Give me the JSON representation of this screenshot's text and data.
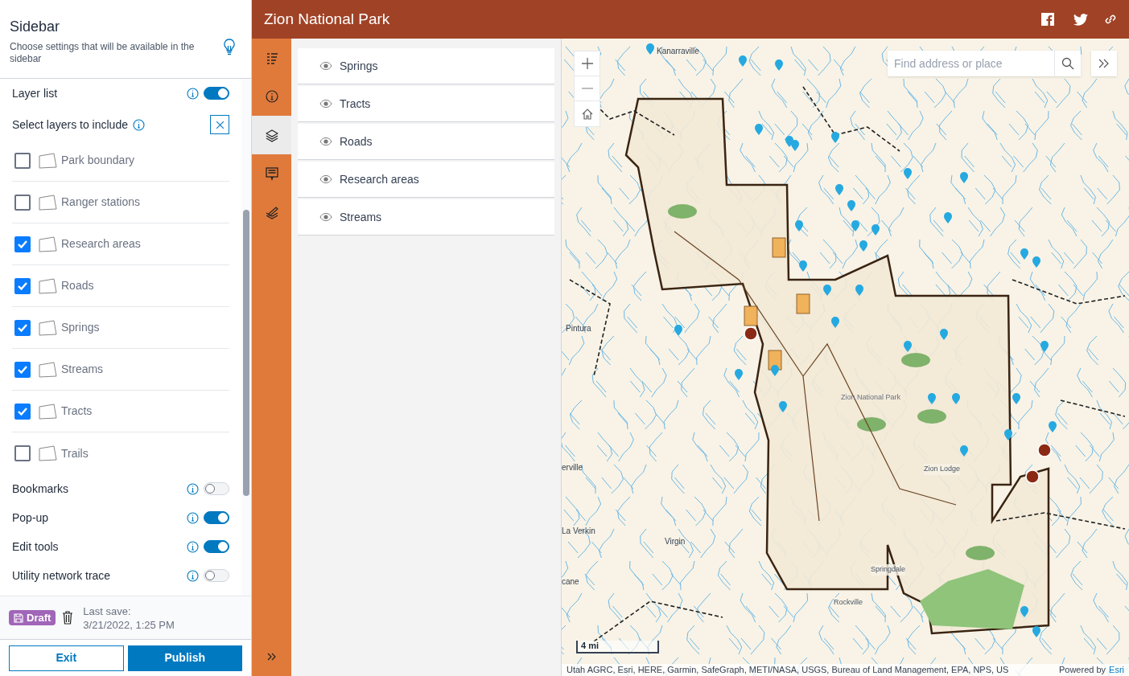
{
  "settings_panel": {
    "title": "Sidebar",
    "description": "Choose settings that will be available in the sidebar",
    "layer_list": {
      "label": "Layer list",
      "on": true
    },
    "layer_select": {
      "label": "Select layers to include",
      "items": [
        {
          "label": "Park boundary",
          "checked": false
        },
        {
          "label": "Ranger stations",
          "checked": false
        },
        {
          "label": "Research areas",
          "checked": true
        },
        {
          "label": "Roads",
          "checked": true
        },
        {
          "label": "Springs",
          "checked": true
        },
        {
          "label": "Streams",
          "checked": true
        },
        {
          "label": "Tracts",
          "checked": true
        },
        {
          "label": "Trails",
          "checked": false
        }
      ]
    },
    "toggles": [
      {
        "label": "Bookmarks",
        "on": false
      },
      {
        "label": "Pop-up",
        "on": true
      },
      {
        "label": "Edit tools",
        "on": true
      },
      {
        "label": "Utility network trace",
        "on": false
      }
    ],
    "status": {
      "badge": "Draft",
      "last_save_label": "Last save:",
      "last_save_time": "3/21/2022, 1:25 PM"
    },
    "buttons": {
      "exit": "Exit",
      "publish": "Publish"
    }
  },
  "app": {
    "title": "Zion National Park",
    "rail": [
      {
        "kind": "legend",
        "selected": false
      },
      {
        "kind": "info",
        "selected": false
      },
      {
        "kind": "layers",
        "selected": true
      },
      {
        "kind": "popup",
        "selected": false
      },
      {
        "kind": "edit",
        "selected": false
      }
    ],
    "layers": [
      {
        "label": "Springs"
      },
      {
        "label": "Tracts"
      },
      {
        "label": "Roads"
      },
      {
        "label": "Research areas"
      },
      {
        "label": "Streams"
      }
    ],
    "map": {
      "search_placeholder": "Find address or place",
      "scale": "4 mi",
      "labels": [
        {
          "text": "Kanarraville",
          "kind": "town"
        },
        {
          "text": "Pintura",
          "kind": "town"
        },
        {
          "text": "erville",
          "kind": "town"
        },
        {
          "text": "La Verkin",
          "kind": "town"
        },
        {
          "text": "Virgin",
          "kind": "town"
        },
        {
          "text": "cane",
          "kind": "town"
        },
        {
          "text": "Zion National Park",
          "kind": "park"
        },
        {
          "text": "Zion Lodge",
          "kind": "place"
        },
        {
          "text": "Springdale",
          "kind": "place"
        },
        {
          "text": "Rockville",
          "kind": "place"
        }
      ],
      "attribution": "Utah AGRC, Esri, HERE, Garmin, SafeGraph, METI/NASA, USGS, Bureau of Land Management, EPA, NPS, US",
      "powered_by": "Powered by",
      "powered_link": "Esri"
    }
  }
}
